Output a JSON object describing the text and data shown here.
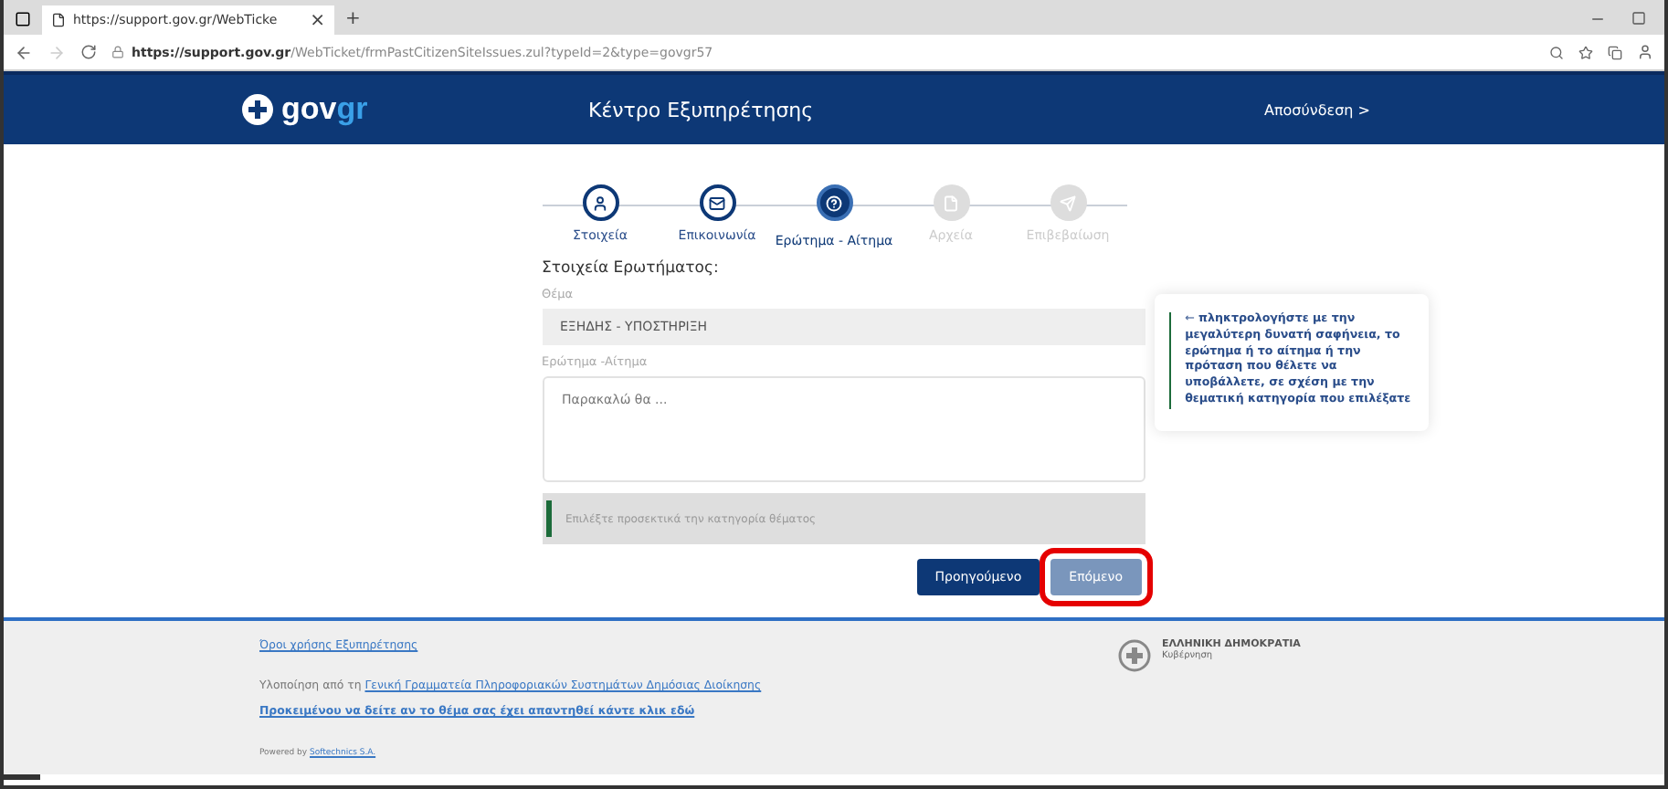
{
  "browser": {
    "tab_title": "https://support.gov.gr/WebTicke",
    "tab_close": "×",
    "new_tab": "+",
    "url_host": "https://support.gov.gr",
    "url_path": "/WebTicket/frmPastCitizenSiteIssues.zul?typeId=2&type=govgr57"
  },
  "header": {
    "logo_text": "gov",
    "logo_accent": "gr",
    "title": "Κέντρο Εξυπηρέτησης",
    "logout": "Αποσύνδεση >"
  },
  "steps": [
    {
      "label": "Στοιχεία",
      "completed": true,
      "selected": false
    },
    {
      "label": "Επικοινωνία",
      "completed": true,
      "selected": false
    },
    {
      "label": "Ερώτημα - Αίτημα",
      "completed": false,
      "selected": true
    },
    {
      "label": "Αρχεία",
      "completed": false,
      "selected": false
    },
    {
      "label": "Επιβεβαίωση",
      "completed": false,
      "selected": false
    }
  ],
  "form": {
    "heading": "Στοιχεία Ερωτήματος:",
    "subject_label": "Θέμα",
    "subject_value": "ΕΞΗΔΗΣ - ΥΠΟΣΤΗΡΙΞΗ",
    "request_label": "Ερώτημα -Αίτημα",
    "request_placeholder": "Παρακαλώ θα ...",
    "notice": "Επιλέξτε προσεκτικά την κατηγορία θέματος"
  },
  "hint": "⇽ πληκτρολογήστε με την μεγαλύτερη δυνατή σαφήνεια, το ερώτημα ή το αίτημα ή την πρόταση που θέλετε να υποβάλλετε, σε σχέση με την θεματική κατηγορία που επιλέξατε",
  "buttons": [
    {
      "label": "Προηγούμενο",
      "kind": "primary",
      "highlighted": false
    },
    {
      "label": "Επόμενο",
      "kind": "secondary",
      "highlighted": true
    }
  ],
  "footer": {
    "terms": "Όροι χρήσης Εξυπηρέτησης",
    "impl_prefix": "Υλοποίηση από τη ",
    "impl_link": "Γενική Γραμματεία Πληροφοριακών Συστημάτων Δημόσιας Διοίκησης",
    "answered_link": "Προκειμένου να δείτε αν το θέμα σας έχει απαντηθεί κάντε κλικ εδώ",
    "powered_prefix": "Powered by ",
    "powered_link": "Softechnics S.A.",
    "org_name": "ΕΛΛΗΝΙΚΗ ΔΗΜΟΚΡΑΤΙΑ",
    "org_sub": "Κυβέρνηση"
  }
}
